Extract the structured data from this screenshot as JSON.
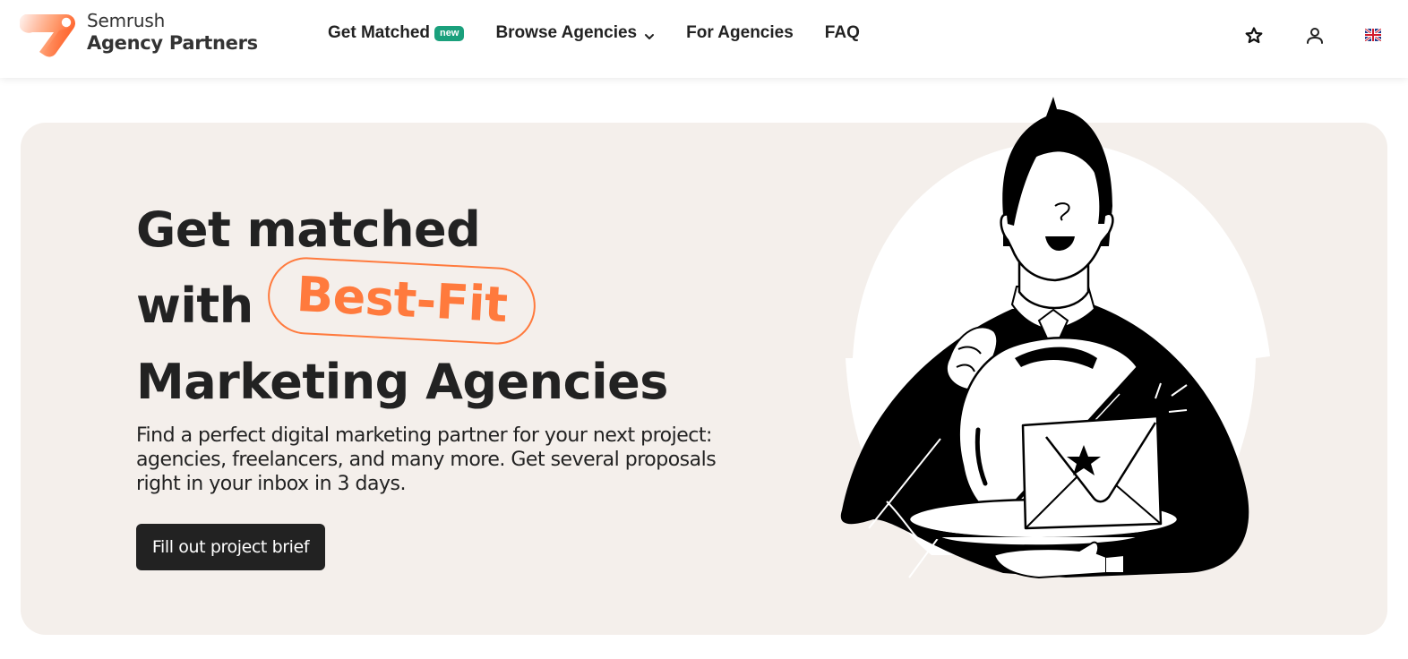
{
  "brand": {
    "name_top": "Semrush",
    "name_bottom": "Agency Partners",
    "accent_color": "#ff642d"
  },
  "nav": {
    "items": [
      {
        "label": "Get Matched",
        "badge": "new"
      },
      {
        "label": "Browse Agencies",
        "has_dropdown": true
      },
      {
        "label": "For Agencies"
      },
      {
        "label": "FAQ"
      }
    ]
  },
  "header_icons": {
    "favorites": "star-icon",
    "account": "user-icon",
    "language": "uk-flag-icon"
  },
  "hero": {
    "headline_line1": "Get matched",
    "headline_line2_prefix": "with",
    "headline_highlight": "Best-Fit",
    "headline_line3": "Marketing Agencies",
    "description": "Find a perfect digital marketing partner for your next project: agencies, freelancers, and many more. Get several proposals right in your inbox in 3 days.",
    "cta_label": "Fill out project brief",
    "illustration": "waiter-serving-envelope-illustration",
    "background_color": "#f4efeb",
    "highlight_color": "#ff7a3d",
    "badge_color": "#1aa07c"
  }
}
